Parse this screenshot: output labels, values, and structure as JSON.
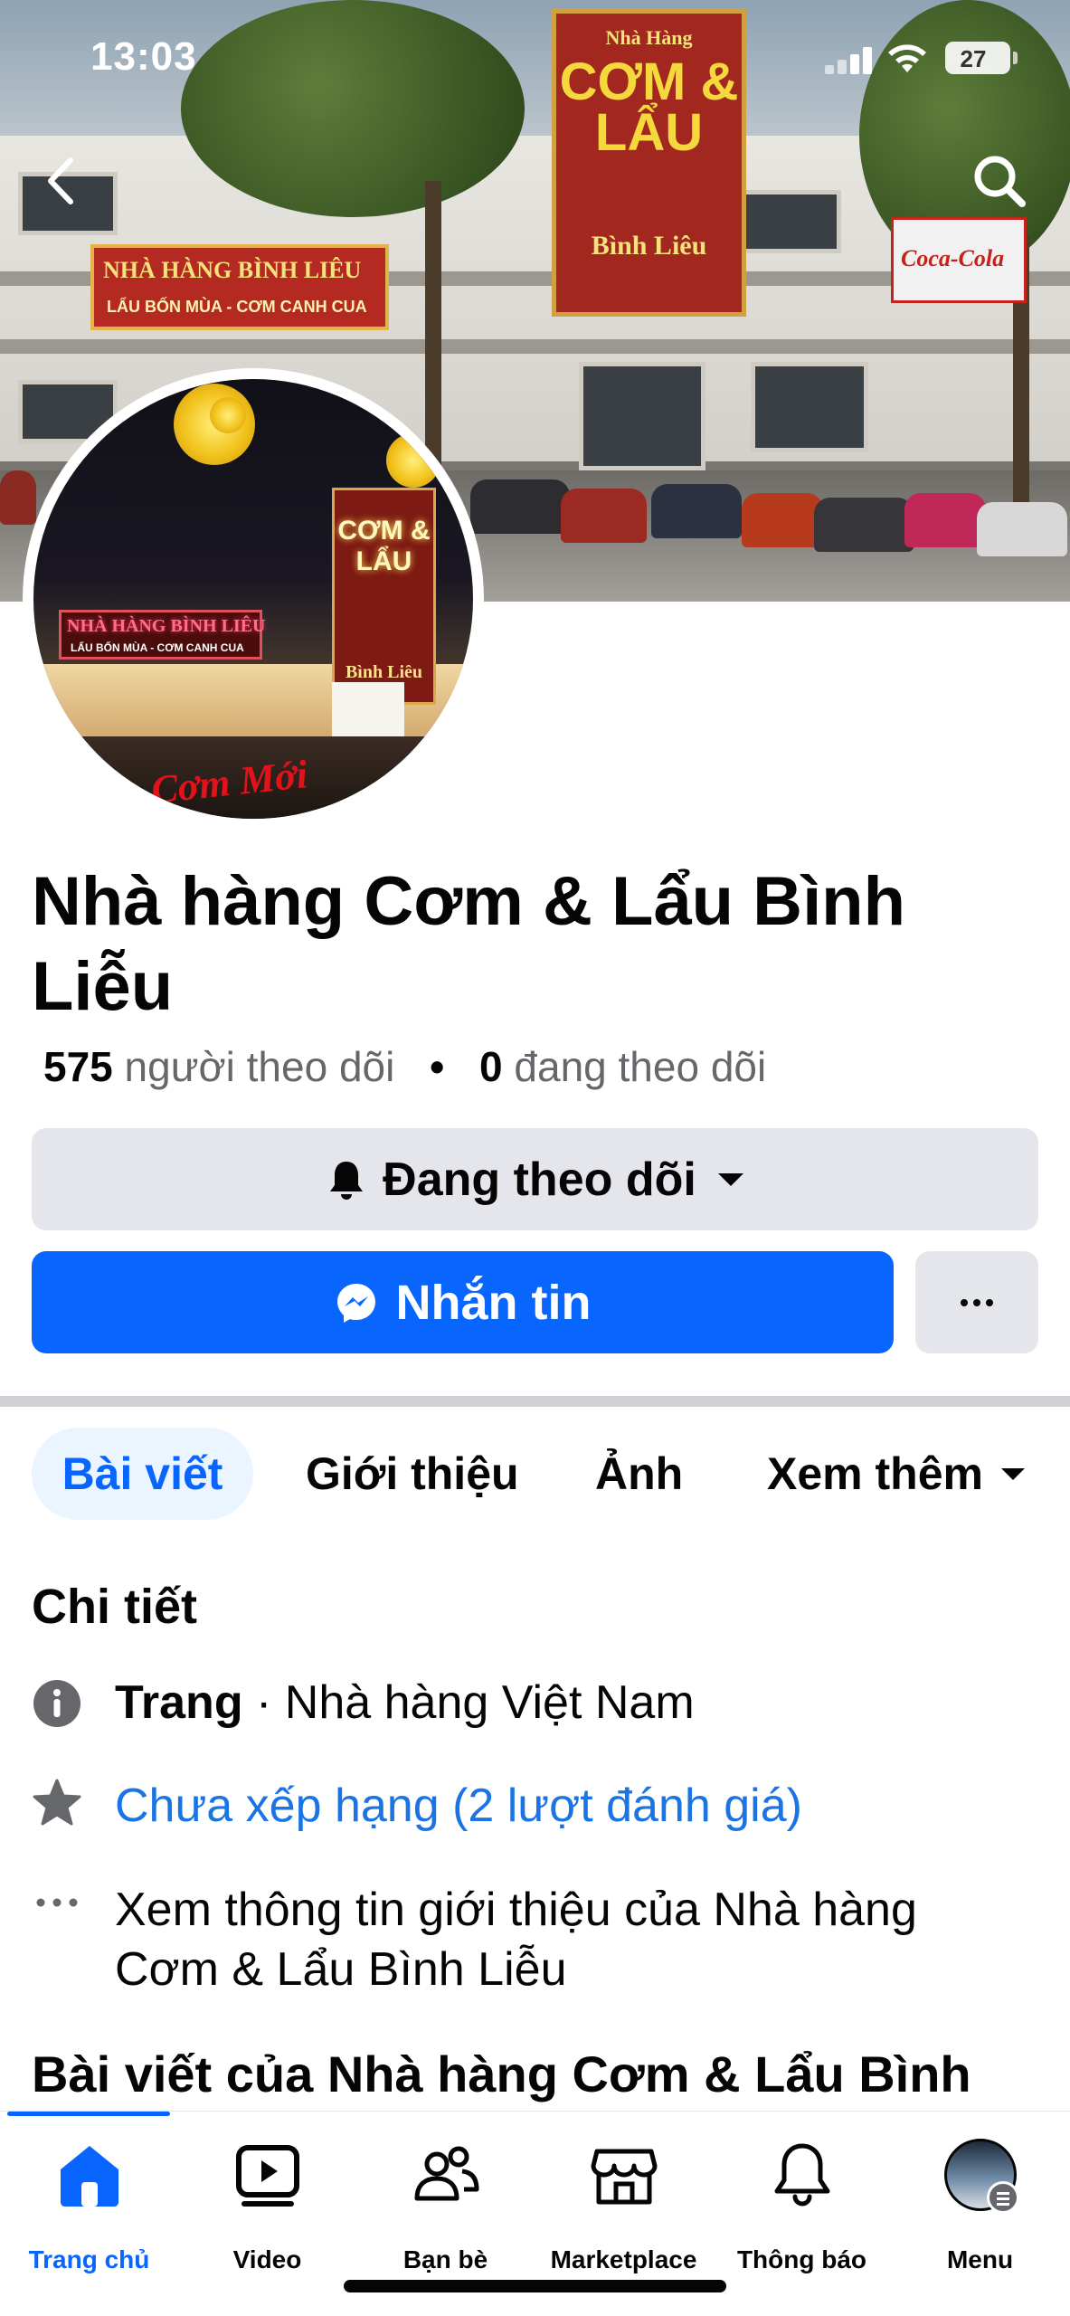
{
  "status_bar": {
    "time": "13:03",
    "battery": "27"
  },
  "cover": {
    "sign_left_line1": "NHÀ HÀNG BÌNH LIÊU",
    "sign_left_line2": "LẨU BỐN MÙA - CƠM CANH CUA",
    "tower_line1": "Nhà Hàng",
    "tower_line2": "CƠM & LẨU",
    "tower_line3": "Bình Liêu",
    "coke_text": "Coca-Cola"
  },
  "avatar": {
    "tower_text": "CƠM & LẨU",
    "tower_sub": "Bình Liêu",
    "sign_line1": "NHÀ HÀNG BÌNH LIÊU",
    "sign_line2": "LẨU BỐN MÙA - CƠM CANH CUA",
    "script_text": "Cơm Mới"
  },
  "page": {
    "title": "Nhà hàng Cơm & Lẩu Bình Liễu",
    "followers_count": "575",
    "followers_label": "người theo dõi",
    "following_count": "0",
    "following_label": "đang theo dõi"
  },
  "buttons": {
    "follow_label": "Đang theo dõi",
    "message_label": "Nhắn tin",
    "more_label": "···"
  },
  "tabs": [
    {
      "label": "Bài viết",
      "active": true
    },
    {
      "label": "Giới thiệu",
      "active": false
    },
    {
      "label": "Ảnh",
      "active": false
    },
    {
      "label": "Xem thêm",
      "active": false
    }
  ],
  "details": {
    "title": "Chi tiết",
    "category_prefix": "Trang",
    "category": " · Nhà hàng Việt Nam",
    "rating": "Chưa xếp hạng (2 lượt đánh giá)",
    "about_line1": "Xem thông tin giới thiệu của Nhà hàng",
    "about_line2": "Cơm & Lẩu Bình Liễu"
  },
  "posts_title": "Bài viết của Nhà hàng Cơm & Lẩu Bình",
  "bottom_nav": [
    {
      "label": "Trang chủ",
      "icon": "home-icon",
      "active": true
    },
    {
      "label": "Video",
      "icon": "video-icon",
      "active": false
    },
    {
      "label": "Bạn bè",
      "icon": "friends-icon",
      "active": false
    },
    {
      "label": "Marketplace",
      "icon": "marketplace-icon",
      "active": false
    },
    {
      "label": "Thông báo",
      "icon": "bell-icon",
      "active": false
    },
    {
      "label": "Menu",
      "icon": "profile-avatar-icon",
      "active": false
    }
  ],
  "colors": {
    "accent": "#0866ff",
    "link": "#1b74e4",
    "button_gray": "#e4e6eb",
    "secondary_text": "#65676b"
  }
}
